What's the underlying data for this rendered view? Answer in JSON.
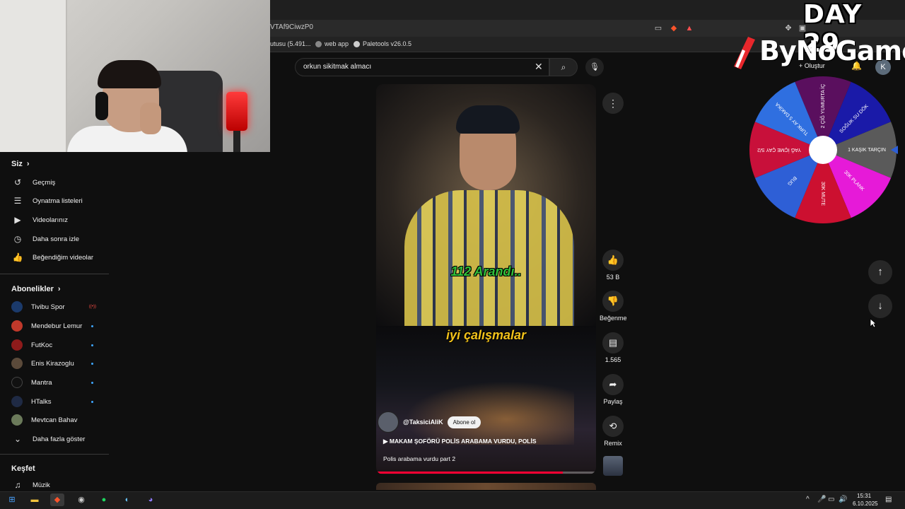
{
  "browser": {
    "url_fragment": "VTAf9CiwzP0",
    "bookmarks": [
      {
        "label": "utusu (5.491..."
      },
      {
        "label": "web app"
      },
      {
        "label": "Paletools v26.0.5"
      }
    ]
  },
  "overlay": {
    "day_label": "DAY 29",
    "logo_text": "ByNoGame",
    "wheel": {
      "center_color": "#ffffff",
      "segments": [
        {
          "label": "2 ÇİĞ YUMURTA İÇ",
          "color": "#5a0f5e"
        },
        {
          "label": "SOĞUK SU DÖK",
          "color": "#1a1aa8"
        },
        {
          "label": "1 KAŞIK TARÇIN",
          "color": "#5a5a5a"
        },
        {
          "label": "30K PLANK",
          "color": "#e61ad8"
        },
        {
          "label": "30K MUTE",
          "color": "#cc1030"
        },
        {
          "label": "BUG",
          "color": "#2e5fd6"
        },
        {
          "label": "YAĞ İÇME ÇAY S/2",
          "color": "#c8103a"
        },
        {
          "label": "TURK AY 5 DAKİKA",
          "color": "#2f6fe0"
        }
      ]
    }
  },
  "youtube": {
    "search": {
      "value": "orkun sikitmak almacı"
    },
    "topbar": {
      "create_label": "Oluştur",
      "account_initial": "K"
    },
    "sidebar": {
      "you_heading": "Siz",
      "you_items": [
        {
          "label": "Geçmiş",
          "icon": "history-icon"
        },
        {
          "label": "Oynatma listeleri",
          "icon": "playlist-icon"
        },
        {
          "label": "Videolarınız",
          "icon": "your-videos-icon"
        },
        {
          "label": "Daha sonra izle",
          "icon": "watch-later-icon"
        },
        {
          "label": "Beğendiğim videolar",
          "icon": "liked-icon"
        }
      ],
      "subs_heading": "Abonelikler",
      "subscriptions": [
        {
          "label": "Tivibu Spor",
          "color": "#1b3a6b",
          "badge": "live"
        },
        {
          "label": "Mendebur Lemur",
          "color": "#c0392b",
          "badge": "dot"
        },
        {
          "label": "FutKoc",
          "color": "#8e1b1b",
          "badge": "dot"
        },
        {
          "label": "Enis Kirazoglu",
          "color": "#5b4a3a",
          "badge": "dot"
        },
        {
          "label": "Mantra",
          "color": "#111111",
          "badge": "dot"
        },
        {
          "label": "HTalks",
          "color": "#1f2a44",
          "badge": "dot"
        },
        {
          "label": "Mevtcan Bahav",
          "color": "#6b7a5a",
          "badge": "none"
        }
      ],
      "show_more": "Daha fazla göster",
      "explore_heading": "Keşfet",
      "explore_items": [
        {
          "label": "Müzik",
          "icon": "music-icon"
        }
      ]
    },
    "short": {
      "caption_top": "112 Arandı..",
      "caption_bottom": "iyi çalışmalar",
      "channel": "@TaksiciAliK",
      "subscribe_label": "Abone ol",
      "title": "MAKAM ŞOFÖRÜ POLİS ARABAMA VURDU, POLİS",
      "description": "Polis arabama vurdu part 2",
      "progress": 0.85
    },
    "actions": {
      "likes": "53 B",
      "dislike_label": "Beğenme",
      "comments": "1.565",
      "share_label": "Paylaş",
      "remix_label": "Remix"
    }
  },
  "taskbar": {
    "time": "15:31",
    "date": "6.10.2025"
  }
}
